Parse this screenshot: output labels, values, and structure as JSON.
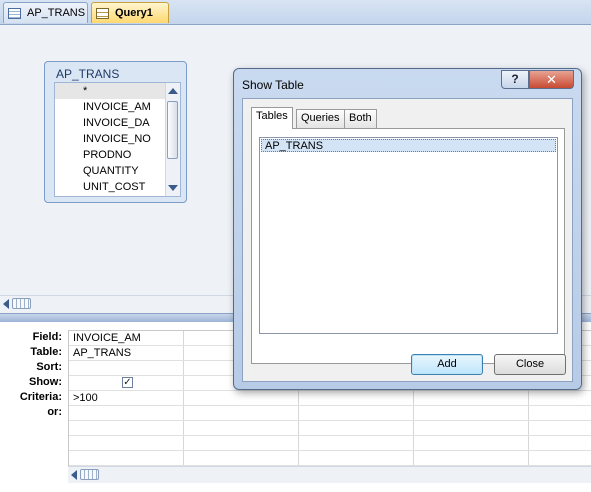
{
  "doc_tabs": [
    {
      "label": "AP_TRANS",
      "active": false
    },
    {
      "label": "Query1",
      "active": true
    }
  ],
  "table_box": {
    "title": "AP_TRANS",
    "fields": [
      "*",
      "INVOICE_AM",
      "INVOICE_DA",
      "INVOICE_NO",
      "PRODNO",
      "QUANTITY",
      "UNIT_COST"
    ]
  },
  "grid": {
    "row_labels": [
      "Field:",
      "Table:",
      "Sort:",
      "Show:",
      "Criteria:",
      "or:"
    ],
    "col1": {
      "field": "INVOICE_AM",
      "table": "AP_TRANS",
      "sort": "",
      "show_checked": "✓",
      "criteria": ">100",
      "or": ""
    }
  },
  "dialog": {
    "title": "Show Table",
    "help": "?",
    "close": "✕",
    "tabs": [
      "Tables",
      "Queries",
      "Both"
    ],
    "list_items": [
      "AP_TRANS"
    ],
    "add_label": "Add",
    "close_label": "Close"
  },
  "colors": {
    "accent": "#3c7fb1",
    "selection": "#d4e4f7",
    "close_red": "#c74a33"
  }
}
